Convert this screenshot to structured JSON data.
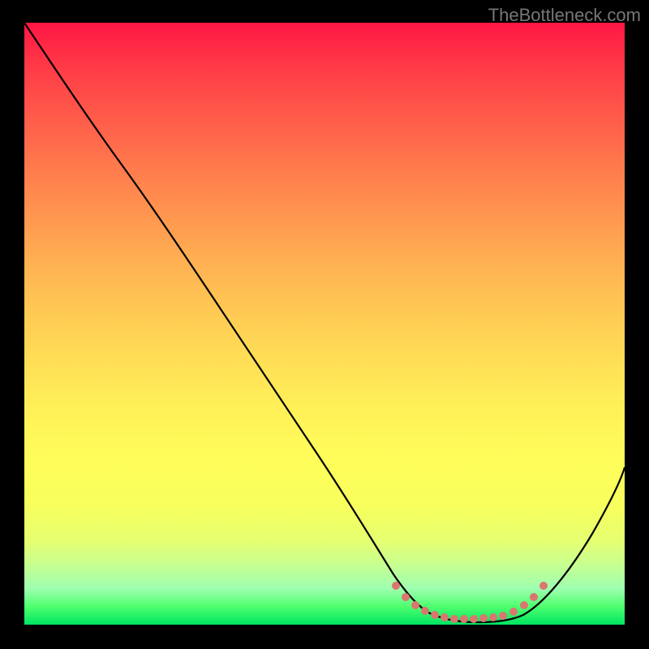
{
  "watermark": "TheBottleneck.com",
  "chart_data": {
    "type": "line",
    "title": "",
    "xlabel": "",
    "ylabel": "",
    "xlim": [
      0,
      100
    ],
    "ylim": [
      0,
      100
    ],
    "series": [
      {
        "name": "curve",
        "x": [
          0,
          5,
          10,
          15,
          20,
          25,
          30,
          35,
          40,
          45,
          50,
          55,
          60,
          63,
          66,
          70,
          74,
          78,
          82,
          86,
          90,
          95,
          100
        ],
        "y": [
          100,
          94,
          87,
          80,
          72,
          65,
          57,
          50,
          42,
          35,
          27,
          20,
          12,
          7,
          3,
          1,
          0,
          0,
          0,
          2,
          7,
          15,
          26
        ],
        "color": "#000000"
      },
      {
        "name": "highlight-dots",
        "x": [
          63,
          65,
          67,
          69,
          71,
          73,
          75,
          77,
          79,
          81,
          83,
          85,
          87
        ],
        "y": [
          6,
          4,
          3,
          2,
          1.3,
          1,
          0.8,
          0.8,
          0.9,
          1.2,
          2.2,
          3.6,
          5.3
        ],
        "color": "#d9776f"
      }
    ],
    "gradient": {
      "top_color": "#ff1744",
      "mid_color": "#fff058",
      "bottom_color": "#00e562"
    }
  }
}
